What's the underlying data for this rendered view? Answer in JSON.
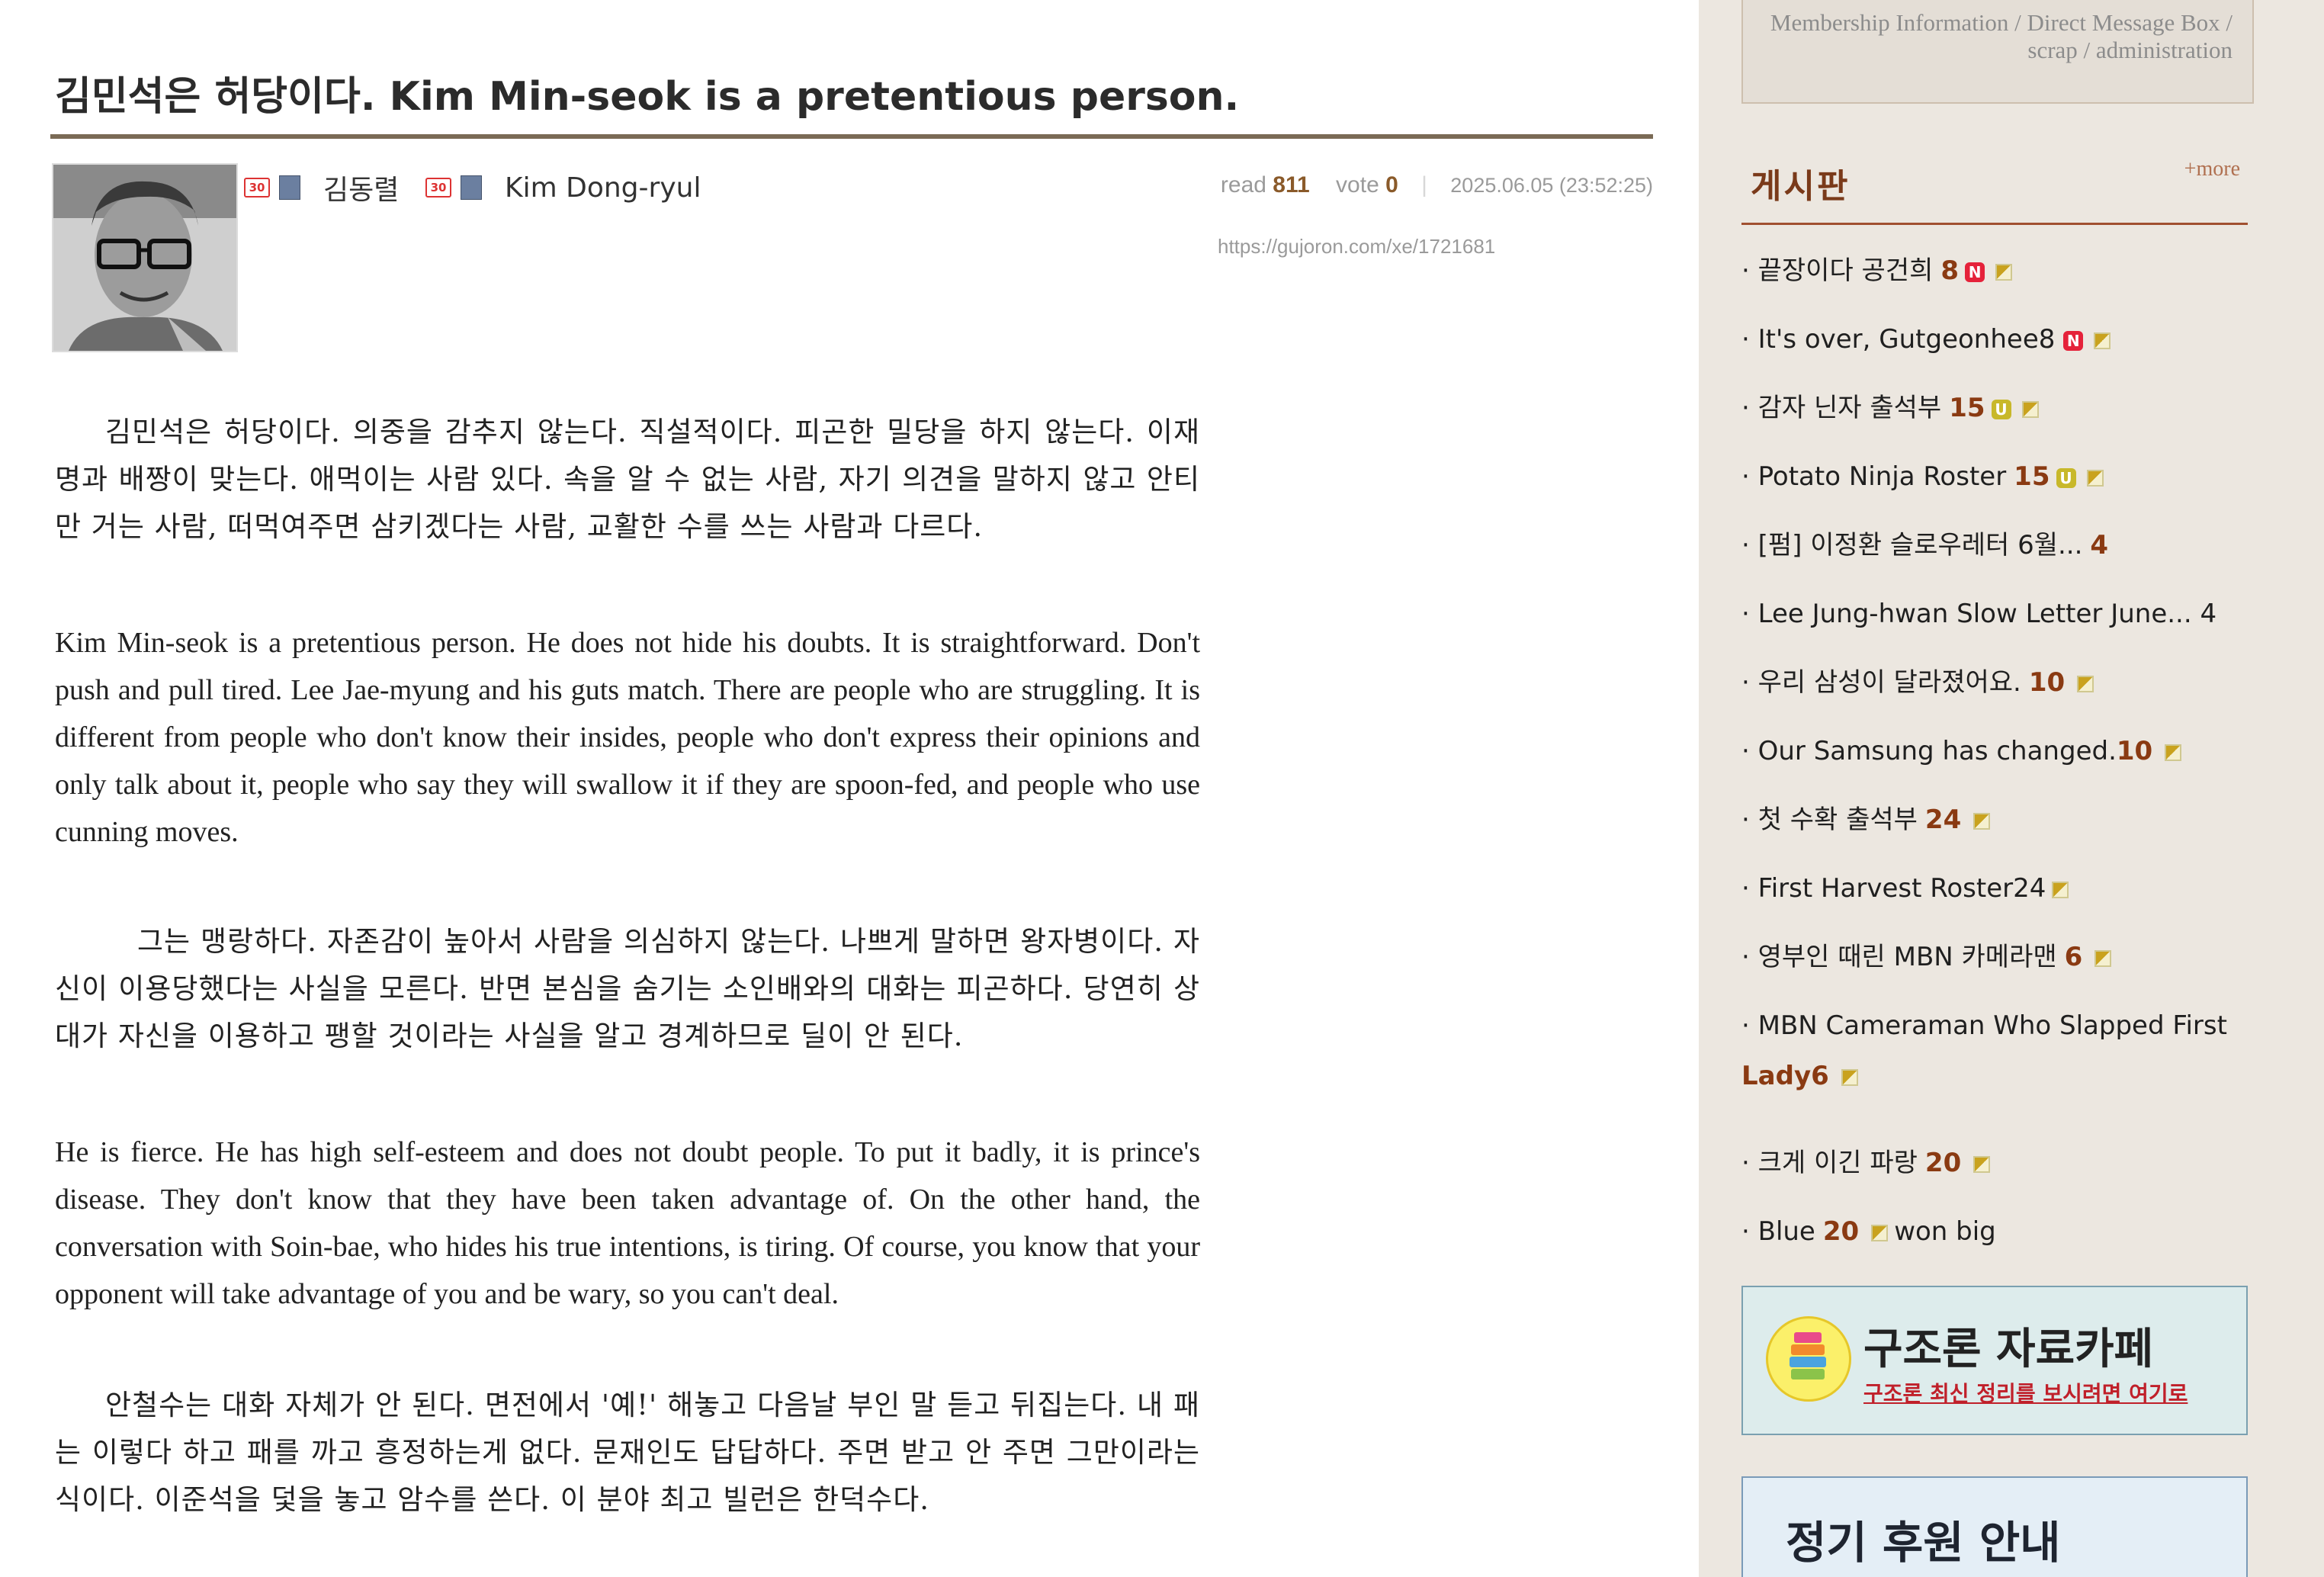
{
  "post": {
    "title": "김민석은 허당이다.  Kim Min-seok is a pretentious person.",
    "authors": [
      {
        "level": "30",
        "name": "김동렬"
      },
      {
        "level": "30",
        "name": "Kim Dong-ryul"
      }
    ],
    "meta": {
      "read_label": "read",
      "read_count": "811",
      "vote_label": "vote",
      "vote_count": "0",
      "date": "2025.06.05 (23:52:25)"
    },
    "url": "https://gujoron.com/xe/1721681",
    "paragraphs": [
      {
        "lang": "ko",
        "text": "김민석은 허당이다. 의중을 감추지 않는다. 직설적이다. 피곤한 밀당을 하지 않는다. 이재명과 배짱이 맞는다. 애먹이는 사람 있다. 속을 알 수 없는 사람, 자기 의견을 말하지 않고 안티만 거는 사람, 떠먹여주면 삼키겠다는 사람, 교활한 수를 쓰는 사람과 다르다."
      },
      {
        "lang": "en",
        "text": "Kim Min-seok is a pretentious person. He does not hide his doubts. It is straightforward. Don't push and pull tired. Lee Jae-myung and his guts match. There are people who are struggling. It is different from people who don't know their insides, people who don't express their opinions and only talk about it, people who say they will swallow it if they are spoon-fed, and people who use cunning moves."
      },
      {
        "lang": "ko",
        "text": "그는 맹랑하다. 자존감이 높아서 사람을 의심하지 않는다. 나쁘게 말하면 왕자병이다. 자신이 이용당했다는 사실을 모른다. 반면 본심을 숨기는 소인배와의 대화는 피곤하다. 당연히 상대가 자신을 이용하고 팽할 것이라는 사실을 알고 경계하므로 딜이 안 된다."
      },
      {
        "lang": "en",
        "text": "He is fierce. He has high self-esteem and does not doubt people. To put it badly, it is prince's disease. They don't know that they have been taken advantage of. On the other hand, the conversation with Soin-bae, who hides his true intentions, is tiring. Of course, you know that your opponent will take advantage of you and be wary, so you can't deal."
      },
      {
        "lang": "ko",
        "text": "안철수는 대화 자체가 안 된다. 면전에서 '예!' 해놓고 다음날 부인 말 듣고 뒤집는다. 내 패는 이렇다 하고 패를 까고 흥정하는게 없다. 문재인도 답답하다. 주면 받고 안 주면 그만이라는 식이다. 이준석을 덫을 놓고 암수를 쓴다. 이 분야 최고 빌런은 한덕수다."
      }
    ]
  },
  "sidebar": {
    "member_links": "Membership Information / Direct Message Box / scrap / administration",
    "board": {
      "title": "게시판",
      "more": "+more",
      "items": [
        {
          "text": "· 끝장이다 공건희",
          "count": "8",
          "badge": "N"
        },
        {
          "text": "· It's over, Gutgeonhee8",
          "count": "",
          "badge": "N"
        },
        {
          "text": "· 감자 닌자 출석부",
          "count": "15",
          "badge": "U"
        },
        {
          "text": "· Potato Ninja Roster",
          "count": "15",
          "badge": "U"
        },
        {
          "text": "· [펌] 이정환 슬로우레터 6월...",
          "count": "4",
          "badge": ""
        },
        {
          "text": "· Lee Jung-hwan Slow Letter June... 4",
          "count": "",
          "badge": ""
        },
        {
          "text": "· 우리 삼성이 달라졌어요.",
          "count": "10",
          "badge": ""
        },
        {
          "text": "· Our Samsung has changed.",
          "count": "10",
          "badge": ""
        },
        {
          "text": "· 첫 수확 출석부",
          "count": "24",
          "badge": ""
        },
        {
          "text": "· First Harvest Roster24",
          "count": "",
          "badge": ""
        },
        {
          "text": "· 영부인 때린 MBN 카메라맨",
          "count": "6",
          "badge": ""
        },
        {
          "text": "· MBN Cameraman Who Slapped First",
          "count": "Lady6",
          "badge": "",
          "double": true
        },
        {
          "text": "· 크게 이긴 파랑",
          "count": "20",
          "badge": ""
        },
        {
          "text": "· Blue",
          "count": "20",
          "badge": "",
          "suffix": "won big"
        }
      ]
    },
    "cafe_banner": {
      "title": "구조론 자료카페",
      "link": "구조론 최신 정리를 보시려면 여기로"
    },
    "support_banner": {
      "title": "정기 후원 안내"
    }
  },
  "colors": {
    "accent": "#8a3a12",
    "title_rule": "#7a6a55",
    "sidebar_bg": "#ece7e0",
    "new_badge": "#e5223a",
    "update_badge": "#c8b82a"
  }
}
